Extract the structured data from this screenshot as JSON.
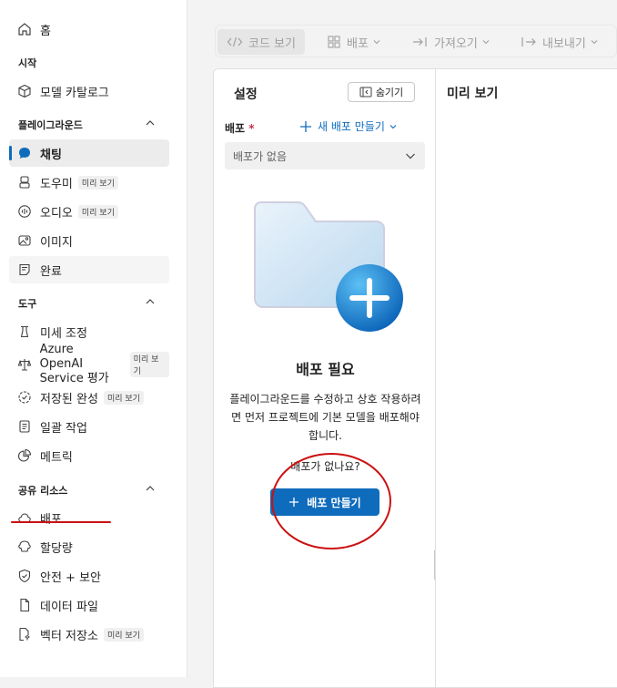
{
  "sidebar": {
    "home": "홈",
    "start_section": "시작",
    "model_catalog": "모델 카탈로그",
    "playground_section": "플레이그라운드",
    "chat": "채팅",
    "assistant": "도우미",
    "audio": "오디오",
    "image": "이미지",
    "completions": "완료",
    "tools_section": "도구",
    "fine_tuning": "미세 조정",
    "azure_eval_line1": "Azure OpenAI",
    "azure_eval_line2": "Service 평가",
    "stored_completions": "저장된 완성",
    "batch_jobs": "일괄 작업",
    "metrics": "메트릭",
    "shared_section": "공유 리소스",
    "deployments": "배포",
    "quota": "할당량",
    "safety": "안전 + 보안",
    "data_files": "데이터 파일",
    "vector_stores": "벡터 저장소",
    "preview_badge": "미리 보기"
  },
  "toolbar": {
    "code_view": "코드 보기",
    "deploy": "배포",
    "import": "가져오기",
    "export": "내보내기"
  },
  "settings": {
    "title": "설정",
    "hide_button": "숨기기",
    "deployment_label": "배포",
    "required_mark": "*",
    "new_deployment": "새 배포 만들기",
    "select_value": "배포가 없음"
  },
  "empty_state": {
    "title": "배포 필요",
    "description": "플레이그라운드를 수정하고 상호 작용하려면 먼저 프로젝트에 기본 모델을 배포해야 합니다.",
    "no_deployments": "배포가 없나요?",
    "create_button": "배포 만들기"
  },
  "preview": {
    "title": "미리 보기"
  },
  "colors": {
    "accent": "#0f6cbd",
    "annotation": "#cc1111"
  }
}
